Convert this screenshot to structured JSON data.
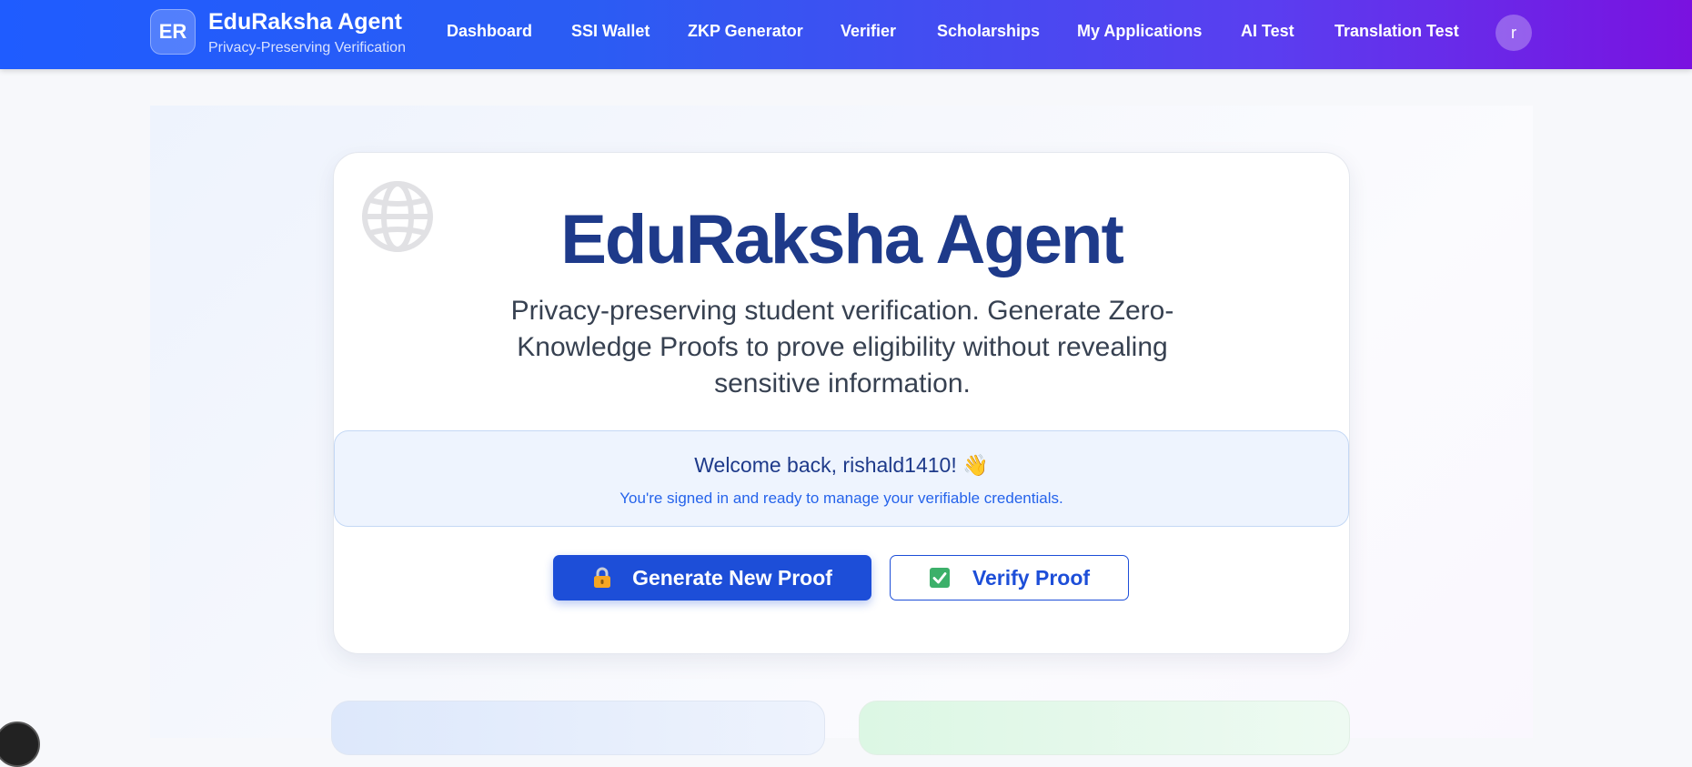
{
  "header": {
    "badge": "ER",
    "title": "EduRaksha Agent",
    "subtitle": "Privacy-Preserving Verification",
    "nav": [
      "Dashboard",
      "SSI Wallet",
      "ZKP Generator",
      "Verifier",
      "Scholarships",
      "My Applications",
      "AI Test",
      "Translation Test"
    ],
    "avatar_initial": "r"
  },
  "hero": {
    "icon": "globe-icon",
    "title": "EduRaksha Agent",
    "description": "Privacy-preserving student verification. Generate Zero-Knowledge Proofs to prove eligibility without revealing sensitive information.",
    "welcome_title": "Welcome back, rishald1410! 👋",
    "welcome_sub": "You're signed in and ready to manage your verifiable credentials.",
    "generate_label": "Generate New Proof",
    "verify_label": "Verify Proof"
  },
  "colors": {
    "accent": "#1d4ed8",
    "title": "#1e3a8a",
    "header_start": "#1f5cff",
    "header_end": "#7a12e0"
  }
}
